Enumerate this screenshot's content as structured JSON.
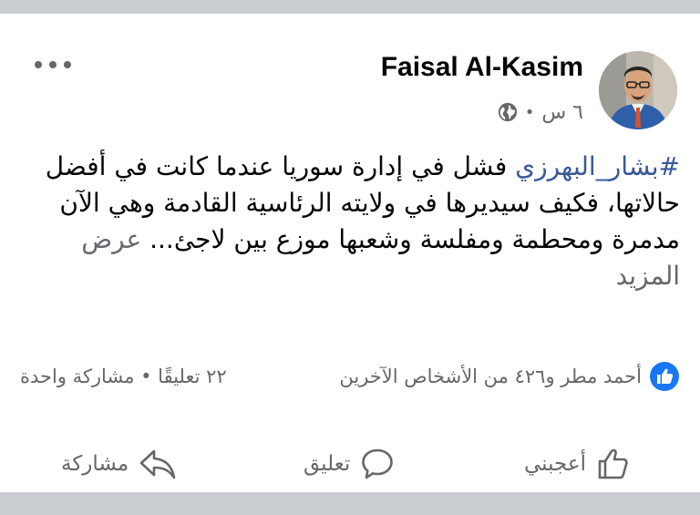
{
  "post": {
    "author": "Faisal Al-Kasim",
    "time": "٦ س",
    "separator": "•",
    "hashtag": "#بشار_البهرزي",
    "body": " فشل في إدارة سوريا عندما كانت في أفضل حالاتها، فكيف سيديرها في ولايته الرئاسية القادمة وهي الآن مدمرة ومحطمة ومفلسة وشعبها موزع بين لاجئ... ",
    "see_more": "عرض المزيد"
  },
  "stats": {
    "reactions_text": "أحمد مطر و٤٢٦ من الأشخاص الآخرين",
    "comments_shares": "٢٢ تعليقًا • مشاركة واحدة"
  },
  "actions": {
    "like": "أعجبني",
    "comment": "تعليق",
    "share": "مشاركة"
  },
  "colors": {
    "accent": "#1877f2",
    "hashtag": "#385898",
    "muted": "#65676b"
  },
  "icons": {
    "more": "more-dots-icon",
    "privacy": "globe-icon",
    "reaction": "like-reaction-icon",
    "like": "thumbs-up-icon",
    "comment": "comment-bubble-icon",
    "share": "share-arrow-icon"
  }
}
